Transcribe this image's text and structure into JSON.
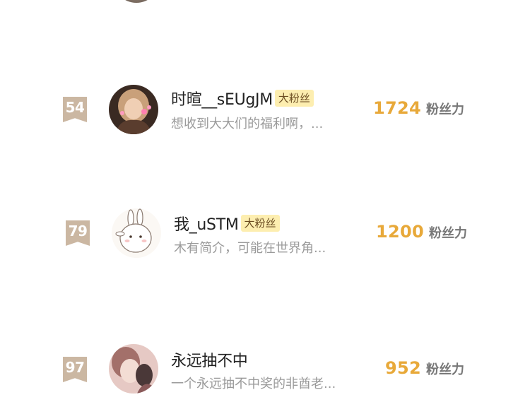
{
  "fan_rank_list": {
    "entries": [
      {
        "rank": "54",
        "nickname": "时暄__sEUgJM",
        "fan_tag": "大粉丝",
        "bio": "想收到大大们的福利啊，...",
        "score": "1724",
        "score_unit": "粉丝力"
      },
      {
        "rank": "79",
        "nickname": "我_uSTM",
        "fan_tag": "大粉丝",
        "bio": "木有简介，可能在世界角...",
        "score": "1200",
        "score_unit": "粉丝力"
      },
      {
        "rank": "97",
        "nickname": "永远抽不中",
        "bio": "一个永远抽不中奖的非酋老...",
        "score": "952",
        "score_unit": "粉丝力"
      }
    ]
  },
  "colors": {
    "rank_badge": "#cbb7a2",
    "score_accent": "#e8a93a",
    "fan_tag_bg": "#fdeeb0",
    "bio_text": "#9a9a9a"
  }
}
